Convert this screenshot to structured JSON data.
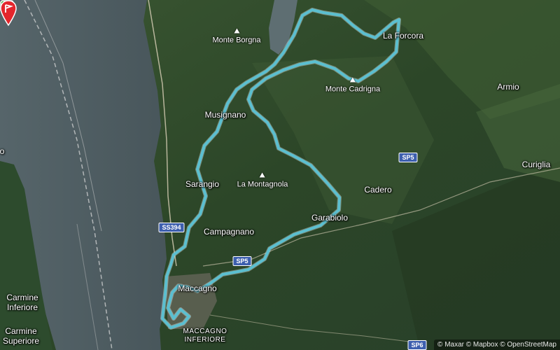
{
  "map": {
    "places": {
      "monte_borgna": "Monte Borgna",
      "la_forcora": "La Forcora",
      "monte_cadrigna": "Monte Cadrigna",
      "armio": "Armio",
      "musignano": "Musignano",
      "curiglia": "Curiglia",
      "sarangio": "Sarangio",
      "la_montagnola": "La Montagnola",
      "cadero": "Cadero",
      "garabiolo": "Garabiolo",
      "campagnano": "Campagnano",
      "maccagno": "Maccagno",
      "carmine_inferiore": "Carmine\nInferiore",
      "carmine_superiore": "Carmine\nSuperiore",
      "maccagno_inferiore": "MACCAGNO\nINFERIORE",
      "edge_o": "o"
    },
    "roads": {
      "ss394": "SS394",
      "sp5_a": "SP5",
      "sp5_b": "SP5",
      "sp6": "SP6"
    },
    "attribution": "© Maxar © Mapbox © OpenStreetMap",
    "colors": {
      "route": "#5bbfd0",
      "lake": "#4b5a60",
      "forest": "#2f4a2b",
      "marker": "#e3262c",
      "start": "#4caf50"
    }
  }
}
